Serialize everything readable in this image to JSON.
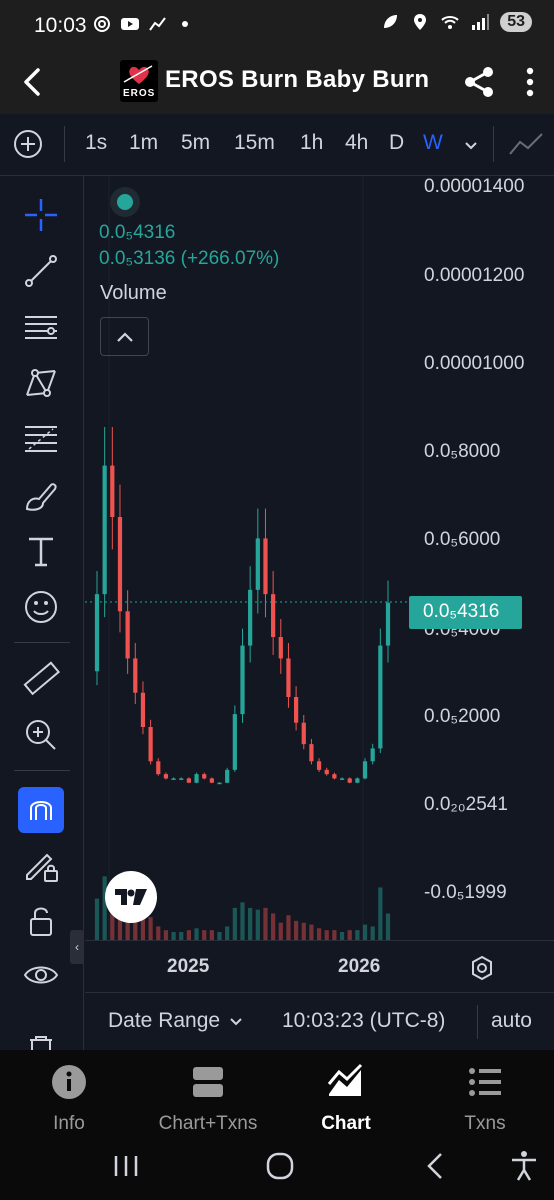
{
  "status_bar": {
    "time": "10:03",
    "battery": "53"
  },
  "header": {
    "title": "EROS Burn Baby Burn",
    "logo_text": "EROS"
  },
  "intervals": [
    "1s",
    "1m",
    "5m",
    "15m",
    "1h",
    "4h",
    "D",
    "W"
  ],
  "active_interval": "W",
  "price_axis": [
    "0.00001400",
    "0.00001200",
    "0.00001000",
    "0.0₅8000",
    "0.0₅6000",
    "0.0₅4000",
    "0.0₅2000",
    "0.0₂₀2541",
    "-0.0₅1999"
  ],
  "legend": {
    "price": "0.0₅4316",
    "change": "0.0₅3136 (+266.07%)",
    "volume_label": "Volume"
  },
  "current_price_badge": "0.0₅4316",
  "time_axis": [
    "2025",
    "2026"
  ],
  "range_bar": {
    "date_range": "Date Range",
    "clock": "10:03:23 (UTC-8)",
    "auto": "auto"
  },
  "bottom_nav": [
    {
      "label": "Info",
      "icon": "info-icon"
    },
    {
      "label": "Chart+Txns",
      "icon": "split-view-icon"
    },
    {
      "label": "Chart",
      "icon": "area-chart-icon"
    },
    {
      "label": "Txns",
      "icon": "list-icon"
    }
  ],
  "active_nav": "Chart",
  "colors": {
    "up": "#26a69a",
    "down": "#ef5350",
    "accent": "#2962ff",
    "background": "#131722"
  },
  "chart_data": {
    "type": "candlestick",
    "interval": "W",
    "x_ticks": [
      "2025",
      "2026"
    ],
    "ylim": [
      -2e-06,
      1.4e-05
    ],
    "y_ticks": [
      "0.00001400",
      "0.00001200",
      "0.00001000",
      "0.0₅8000",
      "0.0₅6000",
      "0.0₅4000",
      "0.0₅2000",
      "0.0₂₀2541",
      "-0.0₅1999"
    ],
    "last_price": 4.316e-06,
    "candles_close_approx": [
      4.5e-06,
      7.5e-06,
      6.3e-06,
      4.1e-06,
      3e-06,
      2.2e-06,
      1.4e-06,
      6e-07,
      3e-07,
      2e-07,
      2e-07,
      2e-07,
      1e-07,
      3e-07,
      2e-07,
      1e-07,
      1e-07,
      4e-07,
      1.7e-06,
      3.3e-06,
      4.6e-06,
      5.8e-06,
      4.5e-06,
      3.5e-06,
      3e-06,
      2.1e-06,
      1.5e-06,
      1e-06,
      6e-07,
      4e-07,
      3e-07,
      2e-07,
      2e-07,
      1e-07,
      2e-07,
      6e-07,
      9e-07,
      3.3e-06,
      4.3e-06
    ]
  }
}
